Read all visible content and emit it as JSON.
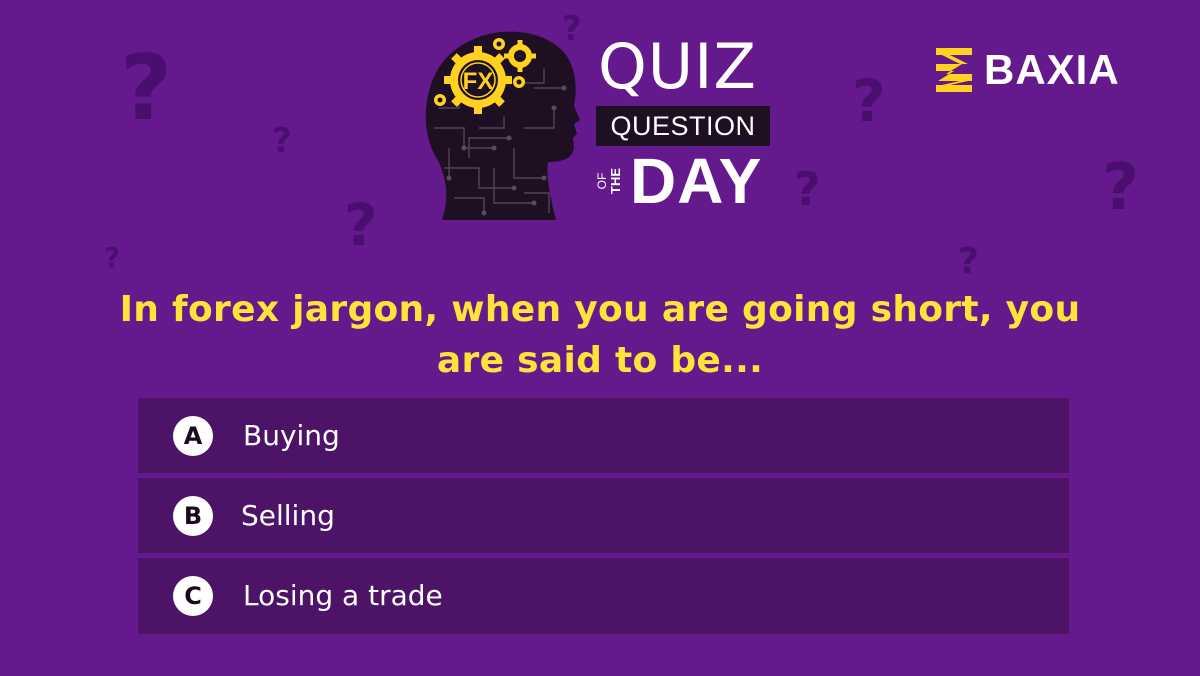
{
  "header": {
    "quiz": "QUIZ",
    "question": "QUESTION",
    "of": "OF",
    "the": "THE",
    "day": "DAY",
    "head_badge": "FX"
  },
  "brand": {
    "name": "BAXIA"
  },
  "background_glyph": "?",
  "main": {
    "question": "In forex jargon, when you are going short, you are said to be...",
    "options": [
      {
        "letter": "A",
        "label": "Buying"
      },
      {
        "letter": "B",
        "label": "Selling"
      },
      {
        "letter": "C",
        "label": "Losing a trade"
      }
    ]
  },
  "colors": {
    "background": "#64198c",
    "option_background": "#4c1366",
    "accent_yellow": "#ffe23a",
    "title_box": "#1e0f23"
  },
  "icons": [
    "head-gears-icon",
    "brand-logo-icon"
  ]
}
